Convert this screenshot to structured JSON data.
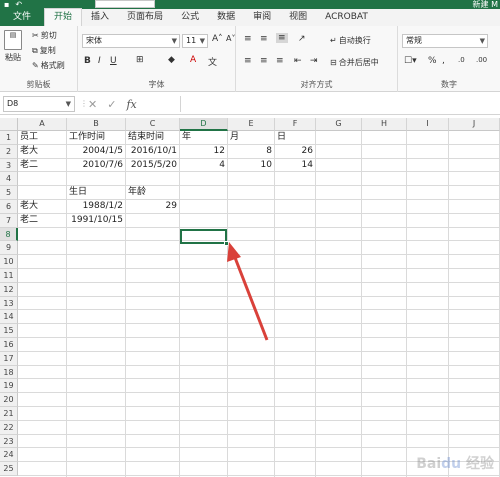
{
  "titlebar": {
    "document_title": "新建 M"
  },
  "tabs": [
    "文件",
    "开始",
    "插入",
    "页面布局",
    "公式",
    "数据",
    "审阅",
    "视图",
    "ACROBAT"
  ],
  "ribbon": {
    "clipboard": {
      "label": "剪贴板",
      "paste": "粘贴",
      "cut": "剪切",
      "copy": "复制",
      "format_painter": "格式刷"
    },
    "font": {
      "label": "字体",
      "font_name": "宋体",
      "font_size": "11"
    },
    "alignment": {
      "label": "对齐方式",
      "wrap_text": "自动换行",
      "merge_center": "合并后居中"
    },
    "number": {
      "label": "数字",
      "format": "常规"
    }
  },
  "formula_bar": {
    "name_box": "D8",
    "formula": ""
  },
  "columns": [
    "A",
    "B",
    "C",
    "D",
    "E",
    "F",
    "G",
    "H",
    "I",
    "J"
  ],
  "rows": [
    "1",
    "2",
    "3",
    "4",
    "5",
    "6",
    "7",
    "8",
    "9",
    "10",
    "11",
    "12",
    "13",
    "14",
    "15",
    "16",
    "17",
    "18",
    "19",
    "20",
    "21",
    "22",
    "23",
    "24",
    "25"
  ],
  "active_cell": {
    "column": "D",
    "row": "8"
  },
  "cells": {
    "A1": "员工",
    "B1": "工作时间",
    "C1": "结束时间",
    "D1": "年",
    "E1": "月",
    "F1": "日",
    "A2": "老大",
    "B2": "2004/1/5",
    "C2": "2016/10/1",
    "D2": "12",
    "E2": "8",
    "F2": "26",
    "A3": "老二",
    "B3": "2010/7/6",
    "C3": "2015/5/20",
    "D3": "4",
    "E3": "10",
    "F3": "14",
    "B5": "生日",
    "C5": "年龄",
    "A6": "老大",
    "B6": "1988/1/2",
    "C6": "29",
    "A7": "老二",
    "B7": "1991/10/15"
  },
  "colors": {
    "excel_green": "#217346",
    "arrow_red": "#d9413a"
  }
}
